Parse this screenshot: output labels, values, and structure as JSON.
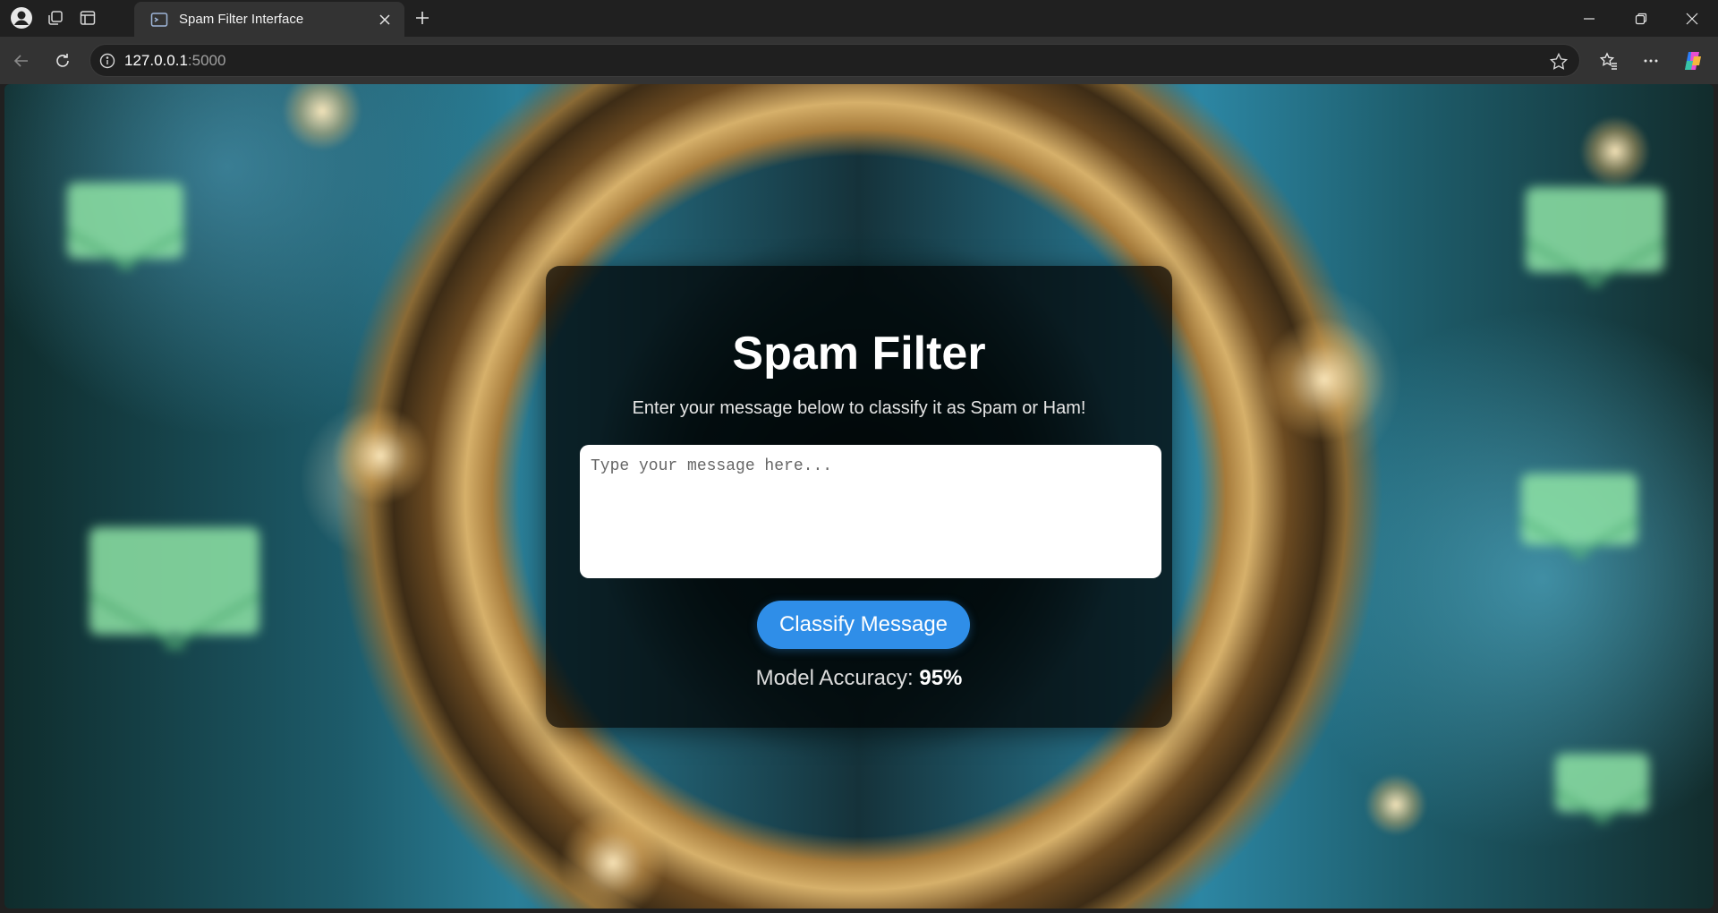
{
  "browser": {
    "tab_title": "Spam Filter Interface",
    "url_host": "127.0.0.1",
    "url_port": ":5000"
  },
  "page": {
    "title": "Spam Filter",
    "subtitle": "Enter your message below to classify it as Spam or Ham!",
    "message_placeholder": "Type your message here...",
    "message_value": "",
    "classify_button": "Classify Message",
    "accuracy_label": "Model Accuracy:",
    "accuracy_value": "95%"
  },
  "colors": {
    "button": "#2f8ee8",
    "card_background": "rgba(0,0,0,0.72)"
  }
}
